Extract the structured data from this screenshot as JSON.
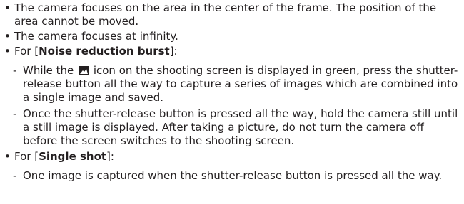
{
  "items": [
    {
      "bullet": "•",
      "text": "The camera focuses on the area in the center of the frame. The position of the area cannot be moved."
    },
    {
      "bullet": "•",
      "text": "The camera focuses at infinity."
    },
    {
      "bullet": "•",
      "prefix": "For [",
      "bold": "Noise reduction burst",
      "suffix": "]:",
      "subitems": [
        {
          "dash": "-",
          "text_before_icon": "While the",
          "icon_name": "landscape-icon",
          "text_after_icon": "icon on the shooting screen is displayed in green, press the shutter-release button all the way to capture a series of images which are combined into a single image and saved."
        },
        {
          "dash": "-",
          "text": "Once the shutter-release button is pressed all the way, hold the camera still until a still image is displayed. After taking a picture, do not turn the camera off before the screen switches to the shooting screen."
        }
      ]
    },
    {
      "bullet": "•",
      "prefix": "For [",
      "bold": "Single shot",
      "suffix": "]:",
      "subitems": [
        {
          "dash": "-",
          "text": "One image is captured when the shutter-release button is pressed all the way."
        }
      ]
    }
  ]
}
